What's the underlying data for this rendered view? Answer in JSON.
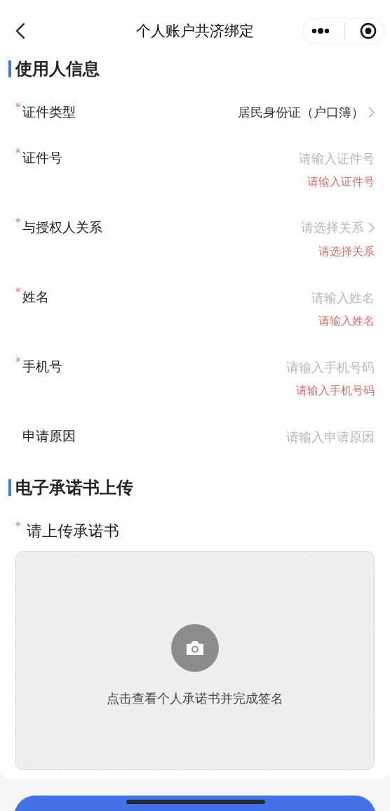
{
  "nav": {
    "title": "个人账户共济绑定"
  },
  "required_mark": "*",
  "sections": [
    {
      "title": "使用人信息",
      "fields": [
        {
          "kind": "select",
          "label": "证件类型",
          "required": true,
          "value": "居民身份证（户口簿）"
        },
        {
          "kind": "input",
          "label": "证件号",
          "required": true,
          "placeholder": "请输入证件号",
          "error": "请输入证件号"
        },
        {
          "kind": "select",
          "label": "与授权人关系",
          "required": true,
          "placeholder": "请选择关系",
          "error": "请选择关系"
        },
        {
          "kind": "input",
          "label": "姓名",
          "required": true,
          "placeholder": "请输入姓名",
          "error": "请输入姓名"
        },
        {
          "kind": "input",
          "label": "手机号",
          "required": true,
          "placeholder": "请输入手机号码",
          "error": "请输入手机号码"
        },
        {
          "kind": "input",
          "label": "申请原因",
          "required": false,
          "placeholder": "请输入申请原因"
        }
      ]
    },
    {
      "title": "电子承诺书上传",
      "upload": {
        "label": "请上传承诺书",
        "required": true,
        "hint": "点击查看个人承诺书并完成签名"
      }
    }
  ]
}
